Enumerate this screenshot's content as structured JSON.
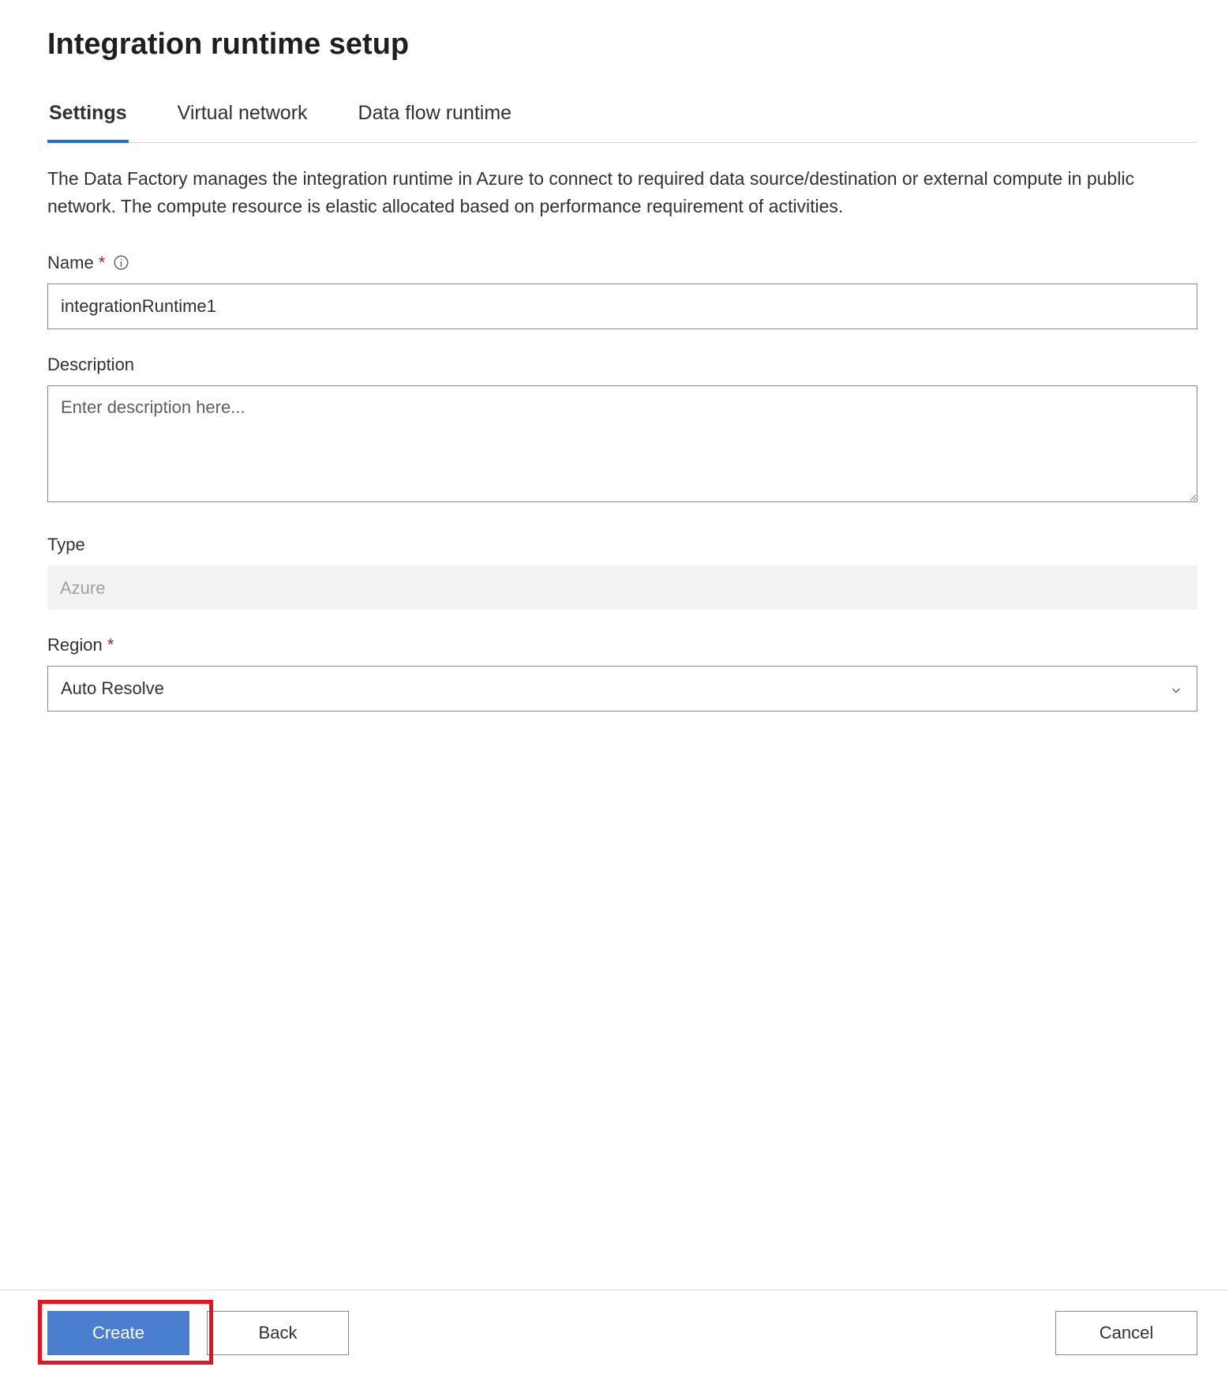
{
  "header": {
    "title": "Integration runtime setup"
  },
  "tabs": {
    "settings": "Settings",
    "virtual_network": "Virtual network",
    "data_flow_runtime": "Data flow runtime"
  },
  "settings": {
    "description": "The Data Factory manages the integration runtime in Azure to connect to required data source/destination or external compute in public network. The compute resource is elastic allocated based on performance requirement of activities.",
    "name_label": "Name",
    "name_value": "integrationRuntime1",
    "description_label": "Description",
    "description_placeholder": "Enter description here...",
    "type_label": "Type",
    "type_value": "Azure",
    "region_label": "Region",
    "region_value": "Auto Resolve"
  },
  "footer": {
    "create": "Create",
    "back": "Back",
    "cancel": "Cancel"
  }
}
